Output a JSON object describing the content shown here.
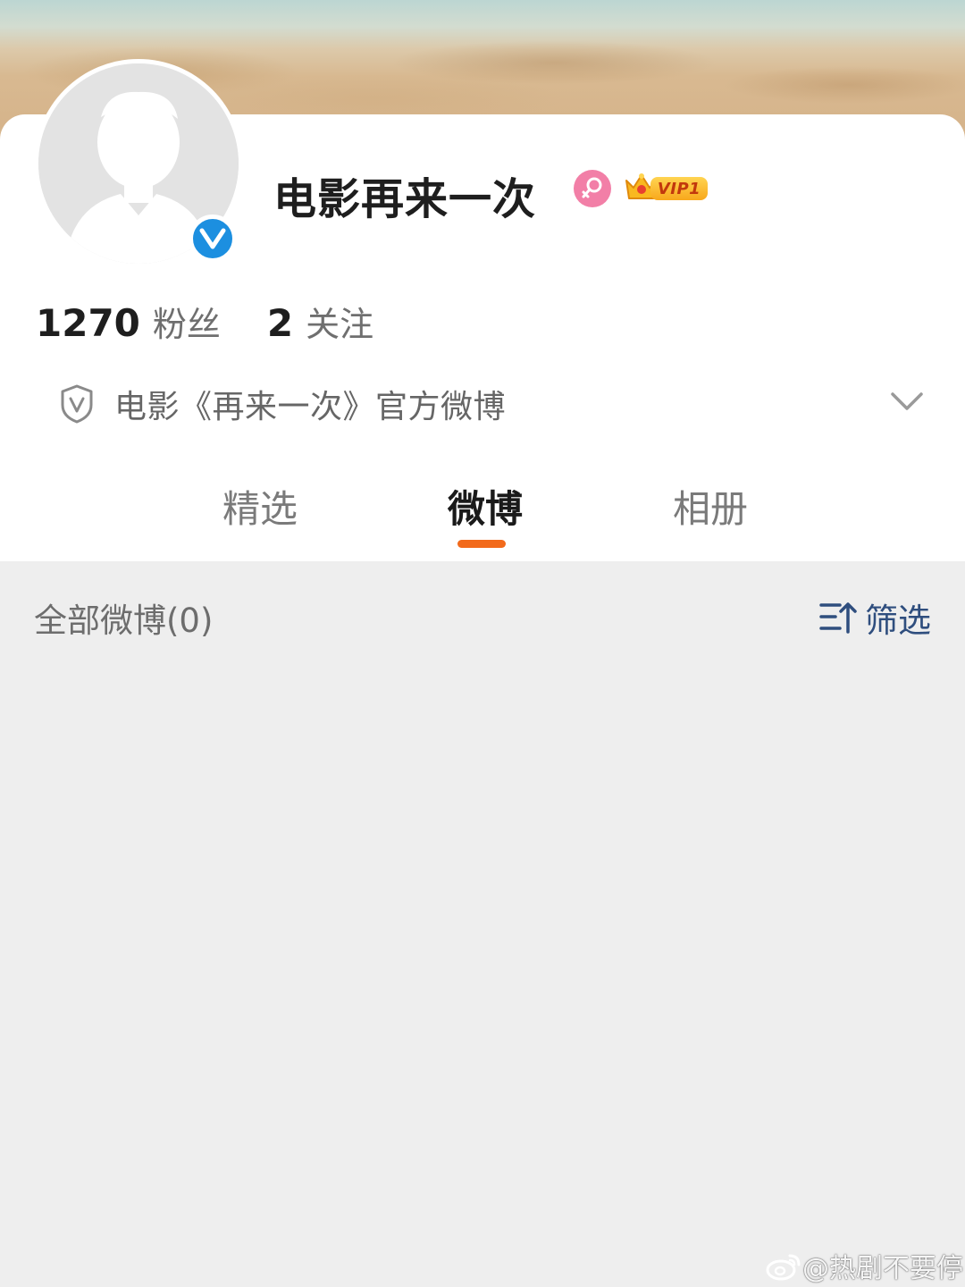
{
  "profile": {
    "name": "电影再来一次",
    "vip_label": "VIP1",
    "gender": "female"
  },
  "stats": {
    "followers_count": "1270",
    "followers_label": "粉丝",
    "following_count": "2",
    "following_label": "关注"
  },
  "verification": {
    "text": "电影《再来一次》官方微博"
  },
  "tabs": [
    {
      "label": "精选",
      "active": false
    },
    {
      "label": "微博",
      "active": true
    },
    {
      "label": "相册",
      "active": false
    }
  ],
  "feed": {
    "count_label": "全部微博(0)",
    "filter_label": "筛选"
  },
  "watermark": {
    "text": "@热剧不要停"
  },
  "colors": {
    "accent": "#f26a1b",
    "verified_blue": "#1c8fe0",
    "filter_blue": "#2f4e7e",
    "gender_pink": "#f27fa7",
    "background": "#eeeeee"
  },
  "icons": [
    "verified-v-icon",
    "female-gender-icon",
    "vip-crown-icon",
    "shield-check-icon",
    "chevron-down-icon",
    "sort-filter-icon",
    "weibo-logo-icon"
  ]
}
